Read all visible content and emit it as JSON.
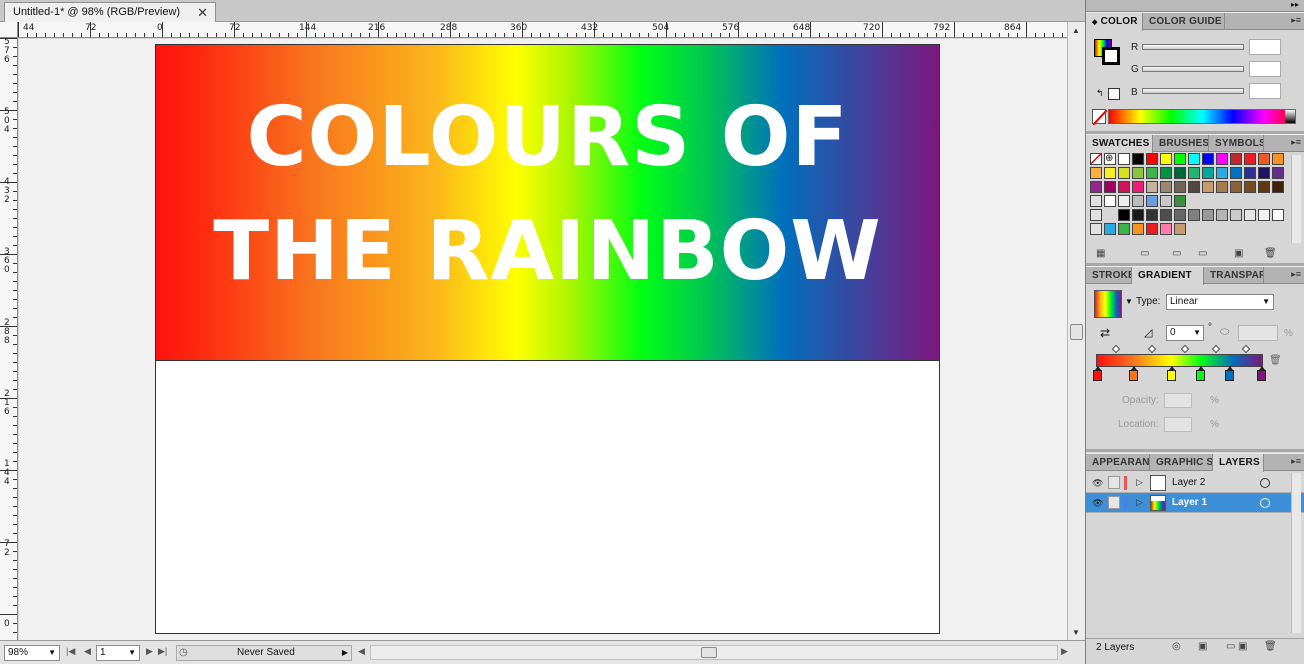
{
  "document": {
    "tab_title": "Untitled-1* @ 98% (RGB/Preview)",
    "close_glyph": "✕",
    "artboard_title": [
      "COLOURS OF",
      "THE RAINBOW"
    ],
    "banner_gradient_colors": [
      "#ff1010",
      "#f8751e",
      "#fbb81b",
      "#ffff00",
      "#aaf500",
      "#00ff13",
      "#00c850",
      "#0070bd",
      "#7d177e"
    ]
  },
  "rulers": {
    "horizontal": [
      "44",
      "72",
      "0",
      "72",
      "144",
      "216",
      "288",
      "360",
      "432",
      "504",
      "576",
      "648",
      "720",
      "792",
      "864"
    ],
    "vertical": [
      "576",
      "504",
      "432",
      "360",
      "288",
      "216",
      "144",
      "72",
      "0"
    ]
  },
  "statusbar": {
    "zoom": "98%",
    "artboard_number": "1",
    "status_text": "Never Saved"
  },
  "panels": {
    "color": {
      "tabs": [
        "COLOR",
        "COLOR GUIDE"
      ],
      "labels": {
        "r": "R",
        "g": "G",
        "b": "B"
      }
    },
    "swatches": {
      "tabs": [
        "SWATCHES",
        "BRUSHES",
        "SYMBOLS"
      ],
      "rows": [
        [
          "#ffffff",
          "#000000",
          "#ff0000",
          "#ffff00",
          "#00ff00",
          "#00ffff",
          "#0000ff",
          "#ff00ff",
          "#c1272d",
          "#ed1c24",
          "#f15a24",
          "#f7931e"
        ],
        [
          "#fbb03b",
          "#fcee21",
          "#d9e021",
          "#8cc63f",
          "#39b54a",
          "#009245",
          "#006837",
          "#22b573",
          "#00a99d",
          "#29abe2",
          "#0071bc",
          "#2e3192",
          "#1b1464",
          "#662d91"
        ],
        [
          "#93278f",
          "#9e005d",
          "#d4145a",
          "#ed1e79",
          "#c7b299",
          "#998675",
          "#736357",
          "#534741",
          "#c69c6d",
          "#a67c52",
          "#8c6239",
          "#754c24",
          "#603813",
          "#42210b"
        ],
        [
          "#ffffff",
          "#eeeeee",
          "#bbbbbb",
          "#6a9ee0",
          "#c8c8c8",
          "#3a8f3a"
        ],
        [
          "#000000",
          "#1a1a1a",
          "#333333",
          "#4d4d4d",
          "#666666",
          "#808080",
          "#999999",
          "#b3b3b3",
          "#cccccc",
          "#e6e6e6",
          "#f2f2f2",
          "#ffffff"
        ],
        [
          "#29abe2",
          "#39b54a",
          "#f7931e",
          "#ed1c24",
          "#ff7bac",
          "#c69c6d"
        ]
      ]
    },
    "gradient": {
      "tabs": [
        "STROKE",
        "GRADIENT",
        "TRANSPAR"
      ],
      "type_label": "Type:",
      "type_value": "Linear",
      "angle_value": "0",
      "degree": "°",
      "percent": "%",
      "opacity_label": "Opacity:",
      "location_label": "Location:",
      "stops": [
        "#ff1010",
        "#f8751e",
        "#ffff00",
        "#00ff13",
        "#0070bd",
        "#7d177e"
      ]
    },
    "layers": {
      "tabs": [
        "APPEARANC",
        "GRAPHIC ST",
        "LAYERS"
      ],
      "items": [
        {
          "name": "Layer 2",
          "color": "#e8555a",
          "selected": false
        },
        {
          "name": "Layer 1",
          "color": "#4d7fe0",
          "selected": true
        }
      ],
      "count_text": "2 Layers"
    }
  }
}
